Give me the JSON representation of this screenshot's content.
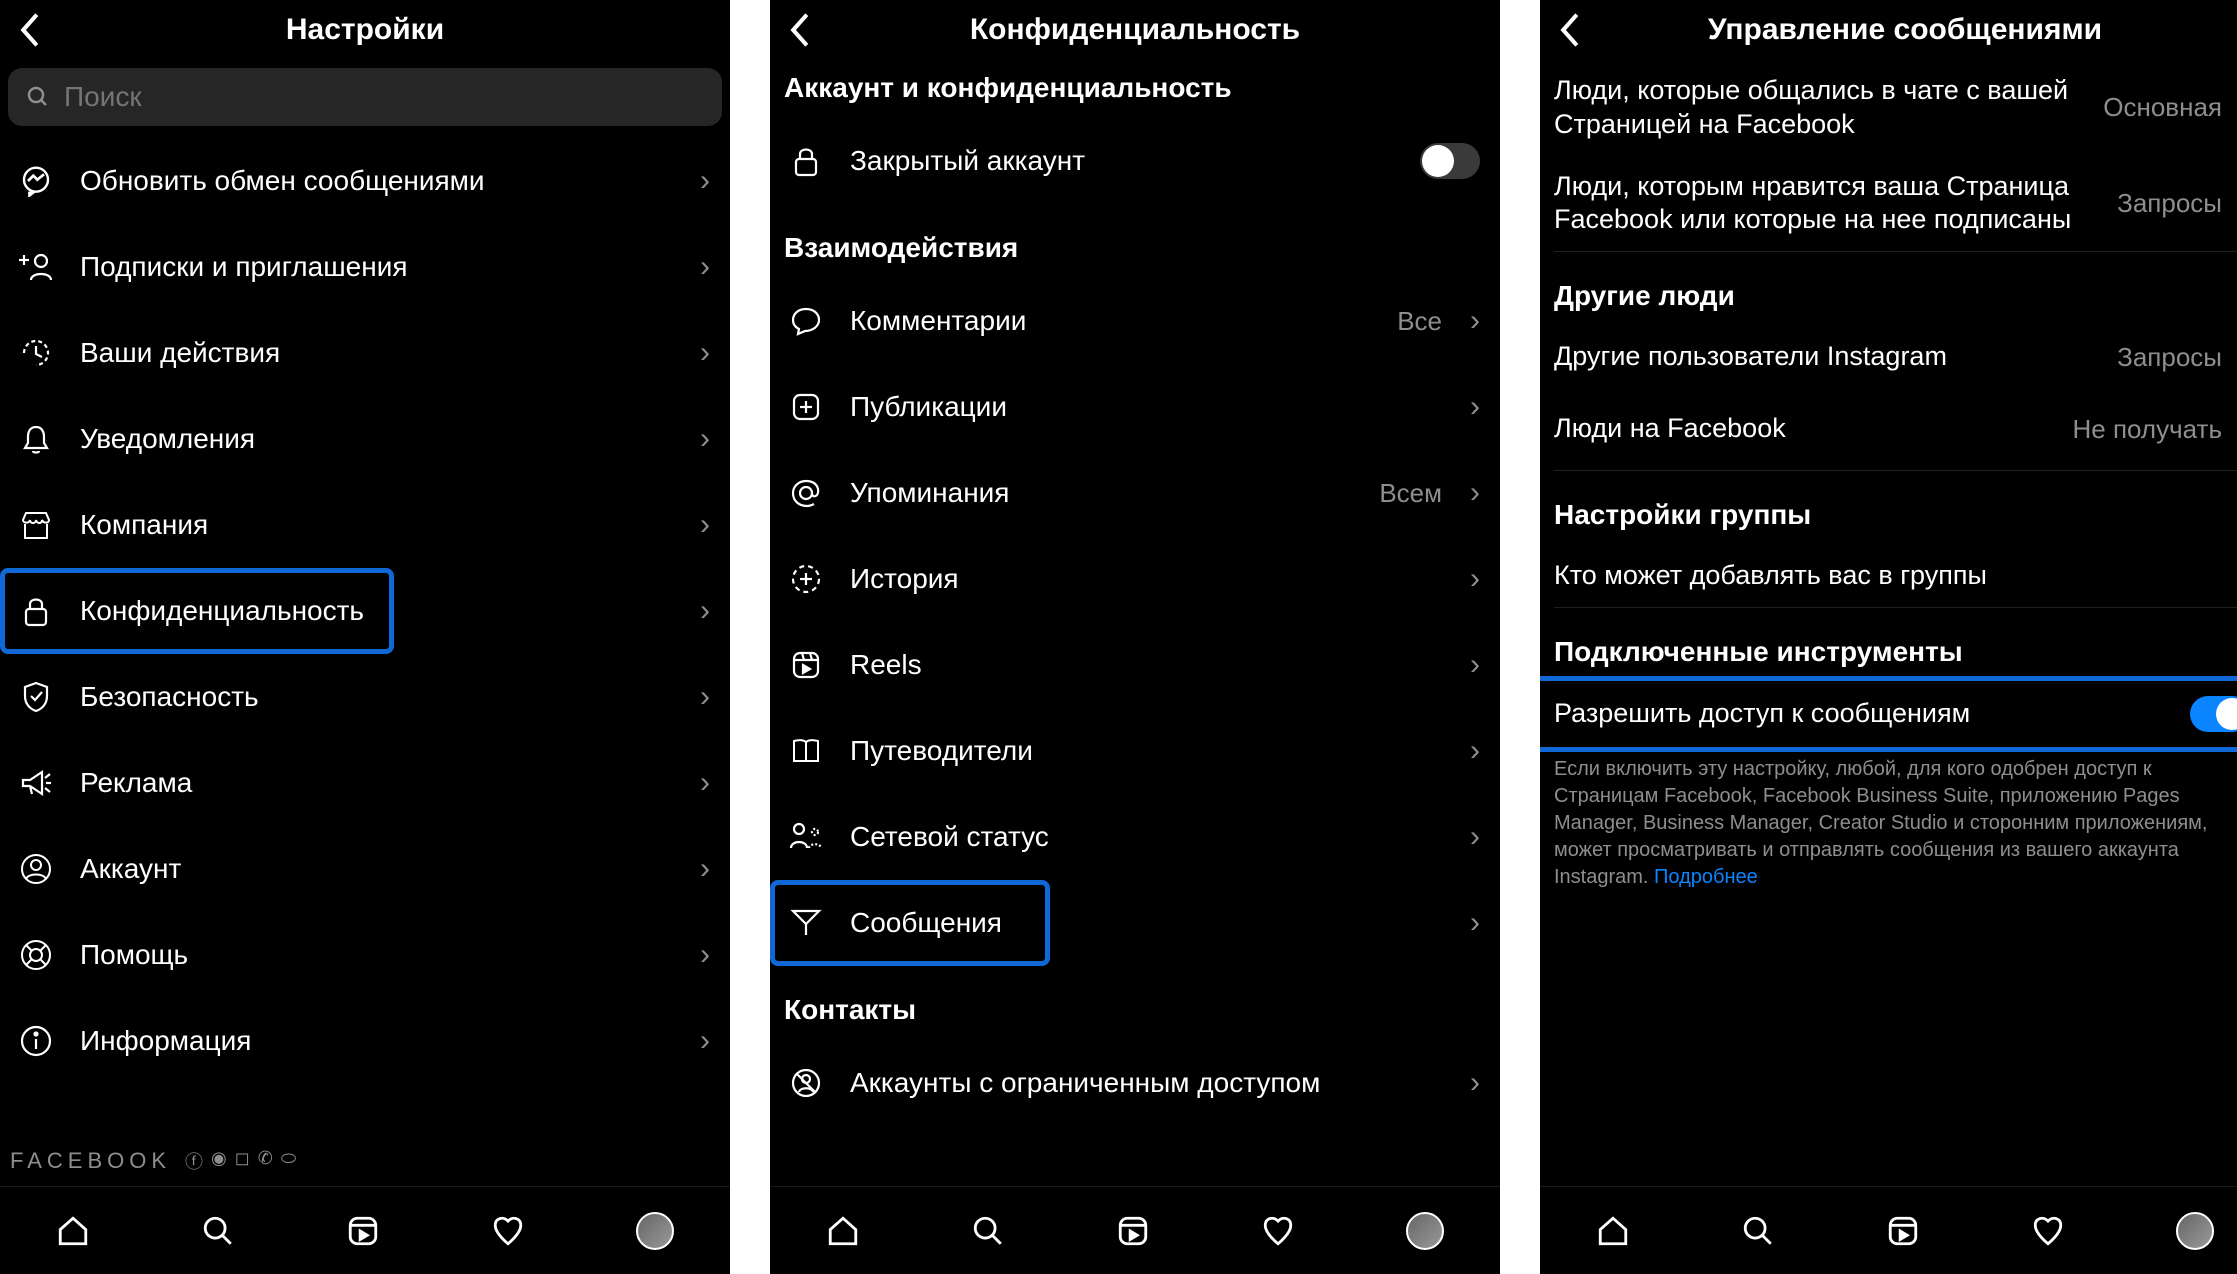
{
  "panel1": {
    "title": "Настройки",
    "search_placeholder": "Поиск",
    "items": [
      {
        "label": "Обновить обмен сообщениями"
      },
      {
        "label": "Подписки и приглашения"
      },
      {
        "label": "Ваши действия"
      },
      {
        "label": "Уведомления"
      },
      {
        "label": "Компания"
      },
      {
        "label": "Конфиденциальность",
        "highlight": true
      },
      {
        "label": "Безопасность"
      },
      {
        "label": "Реклама"
      },
      {
        "label": "Аккаунт"
      },
      {
        "label": "Помощь"
      },
      {
        "label": "Информация"
      }
    ],
    "footer_brand": "FACEBOOK"
  },
  "panel2": {
    "title": "Конфиденциальность",
    "section1": "Аккаунт и конфиденциальность",
    "private_account": "Закрытый аккаунт",
    "section2": "Взаимодействия",
    "items": [
      {
        "label": "Комментарии",
        "value": "Все"
      },
      {
        "label": "Публикации"
      },
      {
        "label": "Упоминания",
        "value": "Всем"
      },
      {
        "label": "История"
      },
      {
        "label": "Reels"
      },
      {
        "label": "Путеводители"
      },
      {
        "label": "Сетевой статус"
      },
      {
        "label": "Сообщения",
        "highlight": true
      }
    ],
    "section3": "Контакты",
    "restricted": "Аккаунты с ограниченным доступом"
  },
  "panel3": {
    "title": "Управление сообщениями",
    "rows": [
      {
        "label": "Люди, которые общались в чате с вашей Страницей на Facebook",
        "value": "Основная"
      },
      {
        "label": "Люди, которым нравится ваша Страница Facebook или которые на нее подписаны",
        "value": "Запросы"
      }
    ],
    "section_others": "Другие люди",
    "others": [
      {
        "label": "Другие пользователи Instagram",
        "value": "Запросы"
      },
      {
        "label": "Люди на Facebook",
        "value": "Не получать"
      }
    ],
    "section_group": "Настройки группы",
    "group_add": "Кто может добавлять вас в группы",
    "section_tools": "Подключенные инструменты",
    "allow_access": "Разрешить доступ к сообщениям",
    "info": "Если включить эту настройку, любой, для кого одобрен доступ к Страницам Facebook, Facebook Business Suite, приложению Pages Manager, Business Manager, Creator Studio и сторонним приложениям, может просматривать и отправлять сообщения из вашего аккаунта Instagram.",
    "info_link": "Подробнее"
  }
}
